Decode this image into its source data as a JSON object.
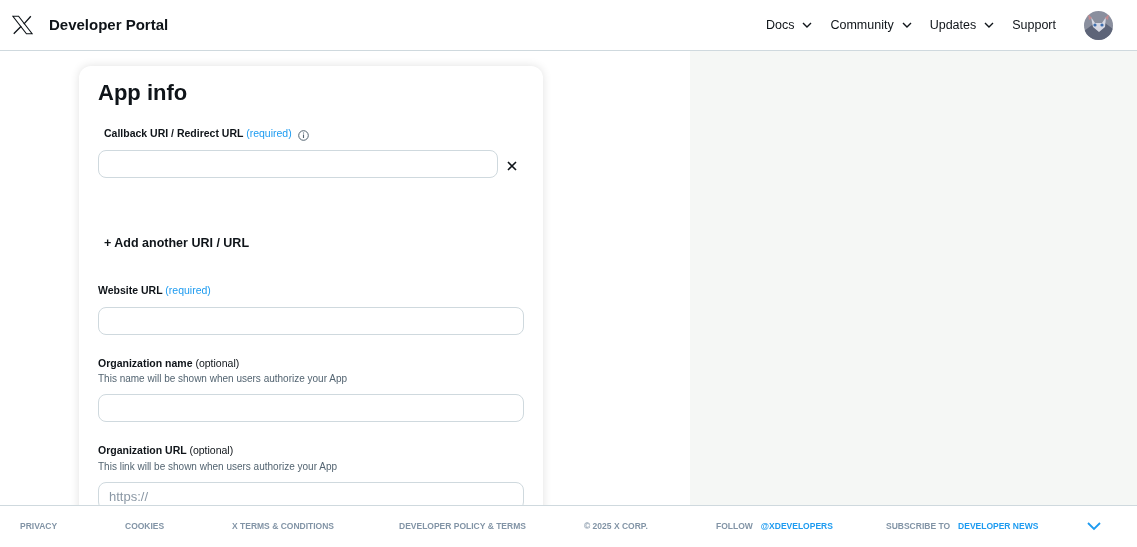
{
  "header": {
    "brand": "Developer Portal",
    "nav": [
      {
        "label": "Docs",
        "dropdown": true
      },
      {
        "label": "Community",
        "dropdown": true
      },
      {
        "label": "Updates",
        "dropdown": true
      },
      {
        "label": "Support",
        "dropdown": false
      }
    ]
  },
  "card": {
    "title": "App info",
    "items": [
      {
        "kind": "field",
        "label": "Callback URI / Redirect URL",
        "tag": "(required)",
        "required": true,
        "info": true,
        "removable": true
      },
      {
        "kind": "add-link",
        "label": "+ Add another URI / URL"
      },
      {
        "kind": "field",
        "label": "Website URL",
        "tag": "(required)",
        "required": true,
        "info": false,
        "removable": false
      },
      {
        "kind": "field",
        "label": "Organization name",
        "tag": "(optional)",
        "required": false,
        "hint": "This name will be shown when users authorize your App",
        "info": false,
        "removable": false
      },
      {
        "kind": "field",
        "label": "Organization URL",
        "tag": "(optional)",
        "required": false,
        "hint": "This link will be shown when users authorize your App",
        "placeholder": "https://",
        "info": false,
        "removable": false
      }
    ]
  },
  "footer": {
    "links": [
      {
        "text": "PRIVACY"
      },
      {
        "text": "COOKIES"
      },
      {
        "text": "X TERMS & CONDITIONS"
      },
      {
        "text": "DEVELOPER POLICY & TERMS"
      },
      {
        "text": "© 2025 X CORP."
      },
      {
        "text": "FOLLOW",
        "link": "@XDEVELOPERS"
      },
      {
        "text": "SUBSCRIBE TO",
        "link": "DEVELOPER NEWS"
      }
    ]
  }
}
